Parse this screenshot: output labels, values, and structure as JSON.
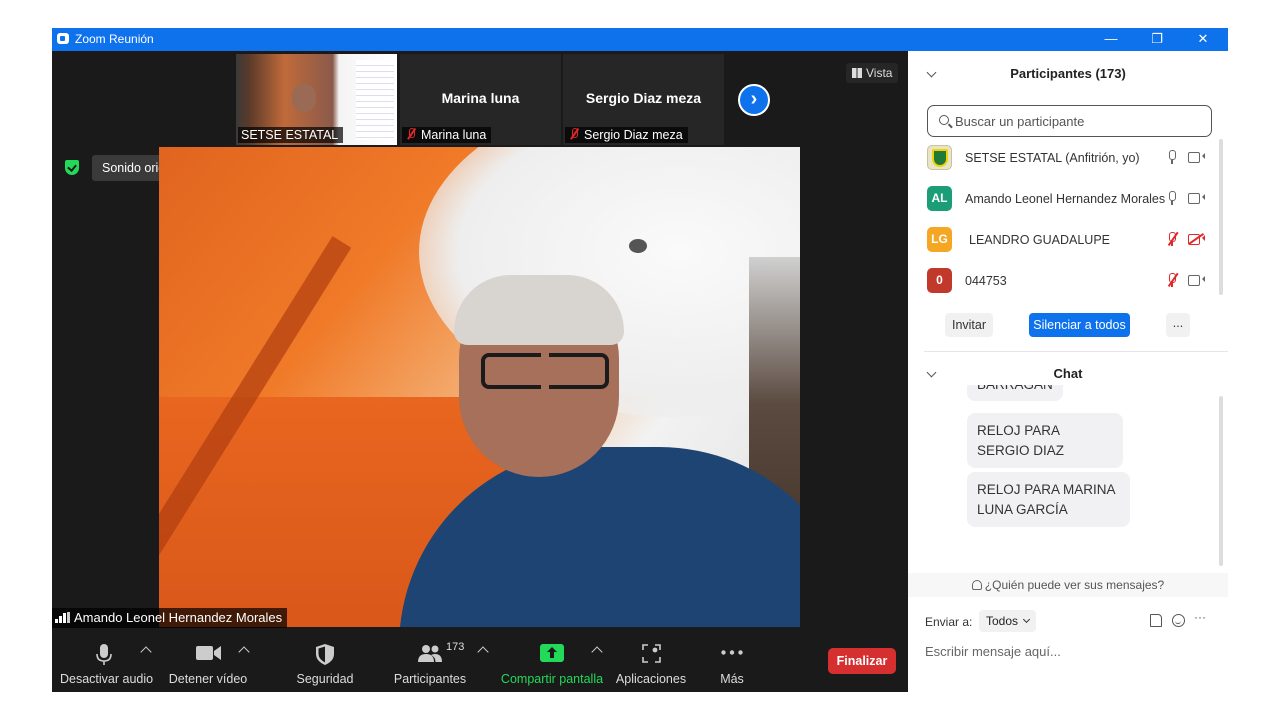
{
  "window": {
    "title": "Zoom Reunión",
    "minimize_label": "—",
    "restore_label": "❐",
    "close_label": "✕"
  },
  "thumbnails": [
    {
      "name_label": "SETSE ESTATAL",
      "muted": false
    },
    {
      "big_name": "Marina luna",
      "name_label": "Marina luna",
      "muted": true
    },
    {
      "big_name": "Sergio Diaz meza",
      "name_label": "Sergio Diaz meza",
      "muted": true
    }
  ],
  "next_arrow": "›",
  "view_button": "Vista",
  "original_sound": "Sonido original: desactivado",
  "active_speaker": "Amando Leonel Hernandez Morales",
  "toolbar": {
    "audio": "Desactivar audio",
    "video": "Detener vídeo",
    "security": "Seguridad",
    "participants": "Participantes",
    "participants_count": "173",
    "share": "Compartir pantalla",
    "apps": "Aplicaciones",
    "more": "Más",
    "end": "Finalizar"
  },
  "participants_panel": {
    "title": "Participantes (173)",
    "search_placeholder": "Buscar un participante",
    "list": [
      {
        "avatar": "",
        "name": "SETSE ESTATAL (Anfitrión, yo)",
        "mic_muted": false,
        "cam_off": false,
        "color": "#e8e4c8"
      },
      {
        "avatar": "AL",
        "name": "Amando Leonel Hernandez Morales",
        "mic_muted": false,
        "cam_off": false,
        "color": "#1b9e77"
      },
      {
        "avatar": "LG",
        "name": "LEANDRO GUADALUPE",
        "mic_muted": true,
        "cam_off": true,
        "color": "#f5a623"
      },
      {
        "avatar": "0",
        "name": "044753",
        "mic_muted": true,
        "cam_off": false,
        "color": "#c0392b"
      }
    ],
    "invite": "Invitar",
    "mute_all": "Silenciar a todos",
    "more": "..."
  },
  "chat": {
    "title": "Chat",
    "messages": [
      {
        "text": "BARRAGAN"
      },
      {
        "text": "RELOJ PARA SERGIO DIAZ"
      },
      {
        "text": "RELOJ PARA MARINA LUNA GARCÍA"
      }
    ],
    "who_can_see": "¿Quién puede ver sus mensajes?",
    "send_to_label": "Enviar a:",
    "send_to_value": "Todos",
    "input_placeholder": "Escribir mensaje aquí...",
    "more_icon": "···"
  },
  "colors": {
    "accent": "#0e72ed",
    "end_button": "#d62f2f",
    "share_green": "#23d959"
  }
}
